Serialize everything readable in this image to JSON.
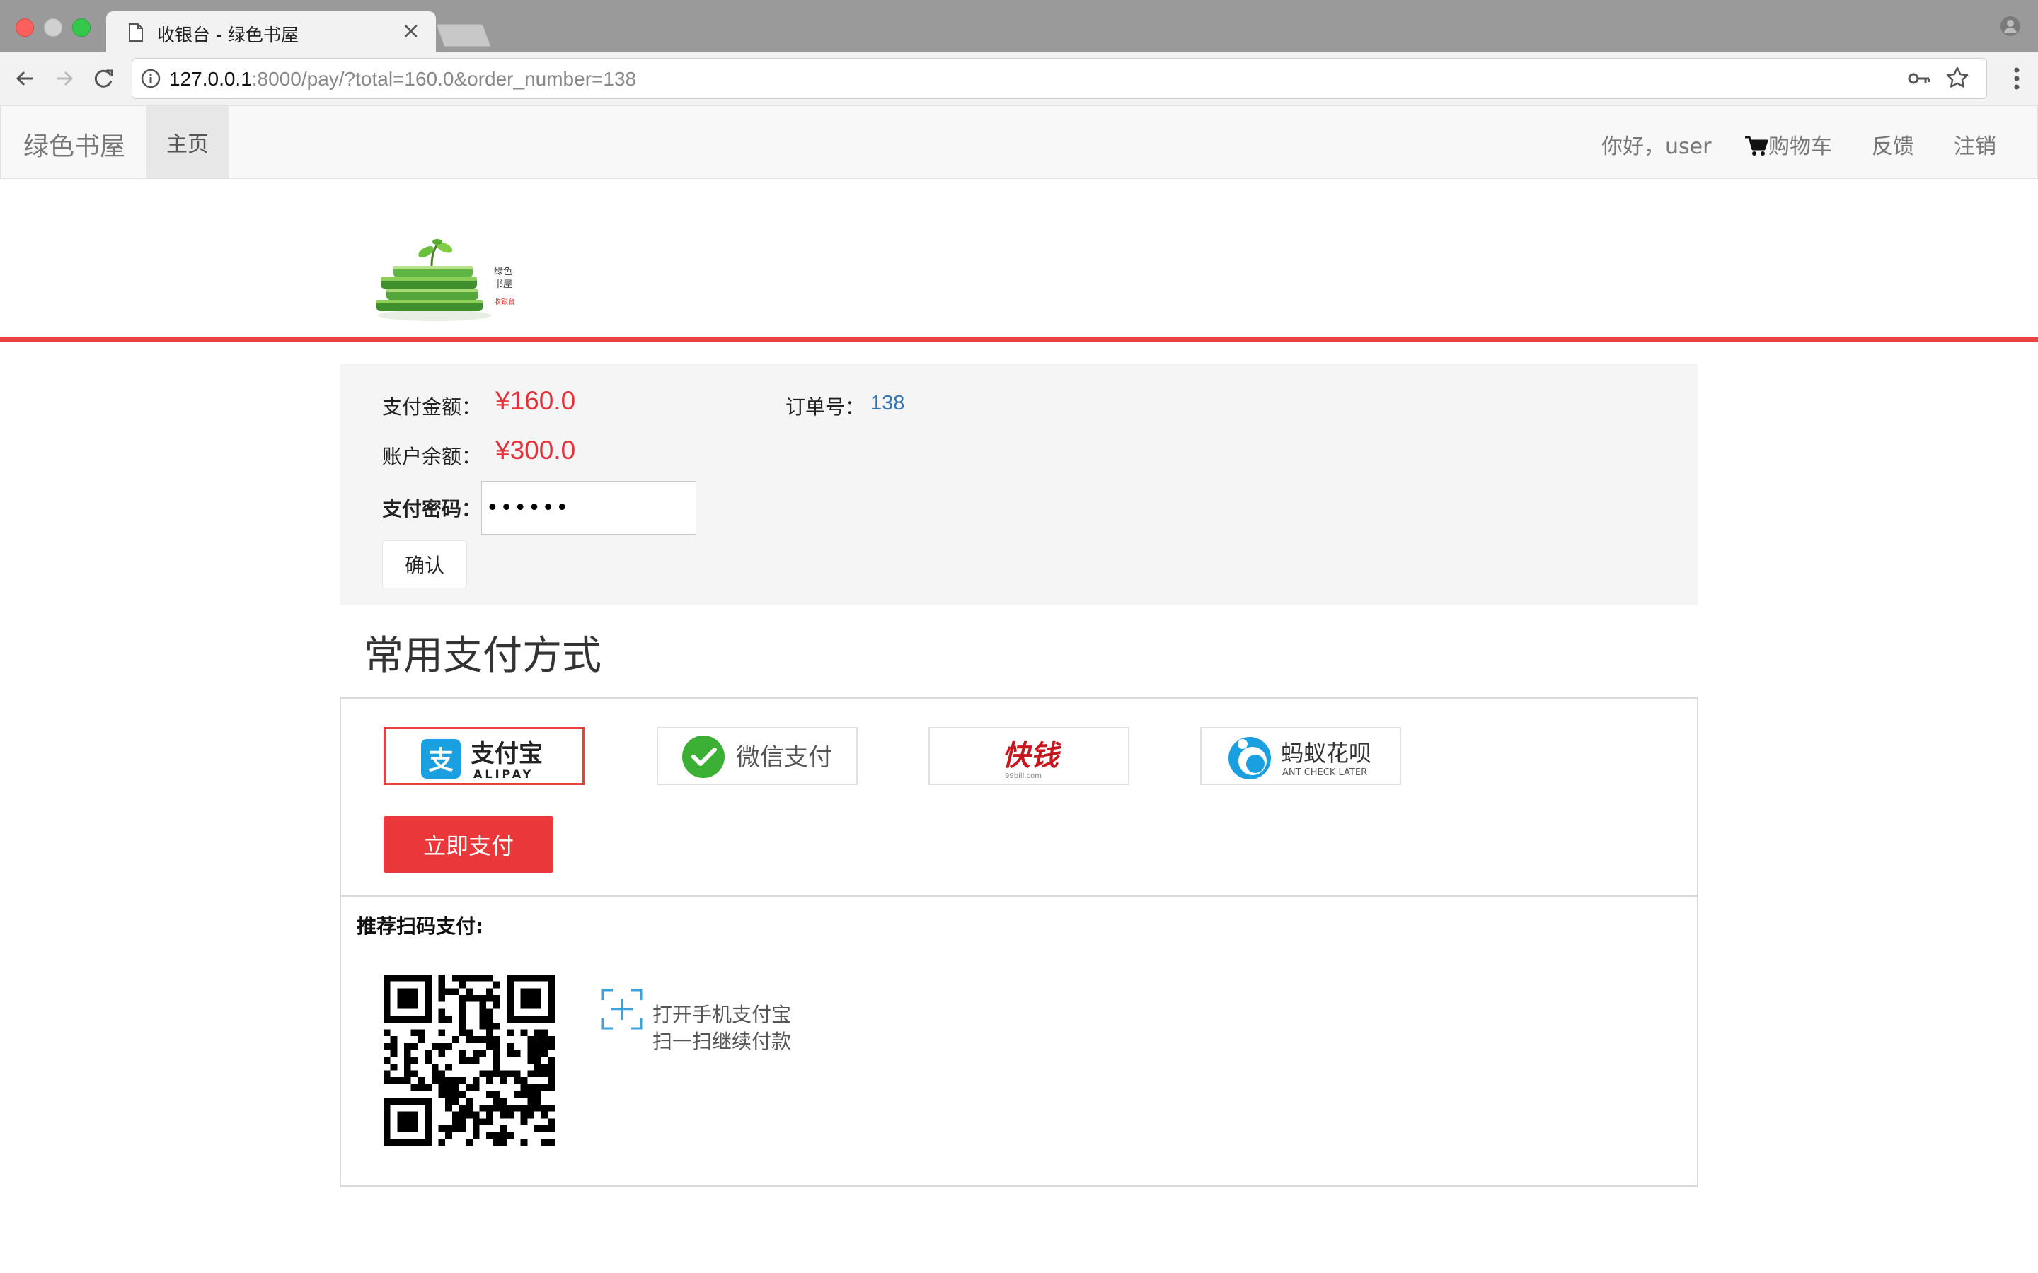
{
  "browser": {
    "tab_title": "收银台 - 绿色书屋",
    "tab_close": "×",
    "url_host": "127.0.0.1",
    "url_rest": ":8000/pay/?total=160.0&order_number=138"
  },
  "navbar": {
    "brand": "绿色书屋",
    "home": "主页",
    "greeting": "你好，user",
    "cart": "购物车",
    "feedback": "反馈",
    "logout": "注销"
  },
  "logo": {
    "line1": "绿色",
    "line2": "书屋",
    "line3": "收银台"
  },
  "payment": {
    "amount_label": "支付金额：",
    "amount_value": "¥160.0",
    "order_label": "订单号：",
    "order_value": "138",
    "balance_label": "账户余额：",
    "balance_value": "¥300.0",
    "password_label": "支付密码：",
    "password_value": "••••••",
    "confirm_label": "确认"
  },
  "methods": {
    "title": "常用支付方式",
    "items": [
      {
        "name": "支付宝",
        "sub": "ALIPAY",
        "selected": true
      },
      {
        "name": "微信支付",
        "selected": false
      },
      {
        "name": "快钱",
        "sub": "99bill.com",
        "selected": false
      },
      {
        "name": "蚂蚁花呗",
        "sub": "ANT CHECK LATER",
        "selected": false
      }
    ],
    "pay_now_label": "立即支付"
  },
  "qr": {
    "title": "推荐扫码支付:",
    "line1": "打开手机支付宝",
    "line2": "扫一扫继续付款"
  },
  "colors": {
    "accent_red": "#e64340",
    "amount_red": "#e5313a",
    "link_blue": "#3572b0",
    "alipay_blue": "#1a9fe0",
    "wechat_green": "#3cb034"
  }
}
